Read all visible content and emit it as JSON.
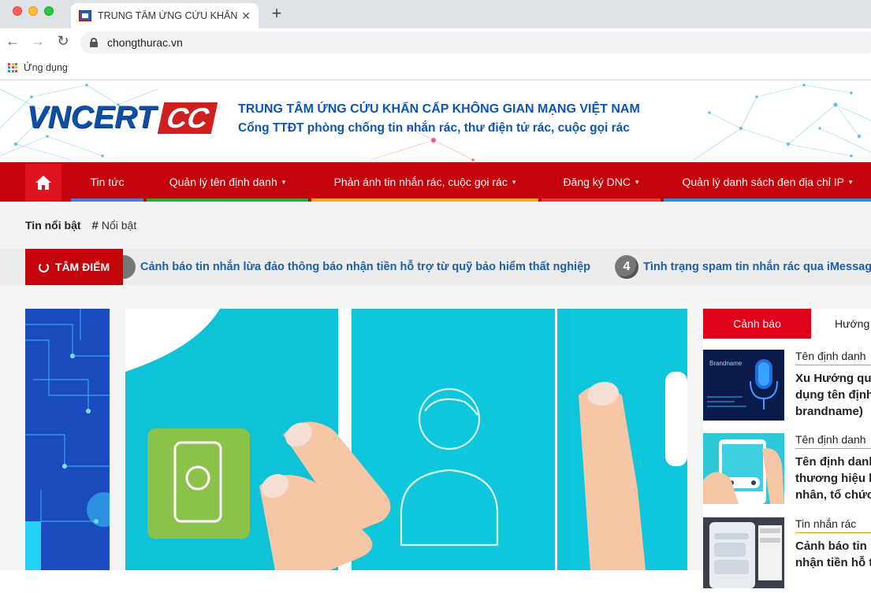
{
  "browser": {
    "tab_title": "TRUNG TÂM ỨNG CỨU KHẨN CẤP",
    "url": "chongthurac.vn",
    "bookmark_apps_label": "Ứng dụng"
  },
  "header": {
    "logo_text": "VNCERT",
    "logo_cc": "CC",
    "title": "TRUNG TÂM ỨNG CỨU KHẨN CẤP KHÔNG GIAN MẠNG VIỆT NAM",
    "subtitle": "Cổng TTĐT phòng chống tin nhắn rác, thư điện tử rác, cuộc gọi rác"
  },
  "nav": {
    "items": [
      {
        "label": "Tin tức",
        "color": "#4a7bd4"
      },
      {
        "label": "Quản lý tên định danh",
        "color": "#2eaa3f"
      },
      {
        "label": "Phản ánh tin nhắn rác, cuộc gọi rác",
        "color": "#f5a623"
      },
      {
        "label": "Đăng ký DNC",
        "color": "#e53935"
      },
      {
        "label": "Quản lý danh sách đen địa chỉ IP",
        "color": "#2b8fd6"
      }
    ]
  },
  "tags": {
    "label": "Tin nổi bật",
    "items": [
      {
        "label": "Nổi bật"
      }
    ]
  },
  "ticker": {
    "label": "TÂM ĐIỂM",
    "items": [
      {
        "text": "Cảnh báo tin nhắn lừa đảo thông báo nhận tiền hỗ trợ từ quỹ bảo hiểm thất nghiệp"
      },
      {
        "number": "4",
        "text": "Tình trạng spam tin nhắn rác qua iMessage"
      }
    ]
  },
  "sidebar": {
    "tabs": [
      {
        "label": "Cảnh báo"
      },
      {
        "label": "Hướng dẫn"
      }
    ],
    "articles": [
      {
        "category": "Tên định danh",
        "title_lines": [
          "Xu Hướng quản",
          "dụng tên định",
          "brandname)"
        ],
        "thumb_text": "Brandname"
      },
      {
        "category": "Tên định danh",
        "title_lines": [
          "Tên định danh",
          "thương hiệu h",
          "nhân, tổ chức"
        ]
      },
      {
        "category": "Tin nhắn rác",
        "title_lines": [
          "Cảnh báo tin",
          "nhận tiền hỗ t"
        ]
      }
    ]
  },
  "colors": {
    "brand_red": "#c4030a",
    "brand_blue": "#0e54b5",
    "ticker_link": "#1d5fa8"
  }
}
